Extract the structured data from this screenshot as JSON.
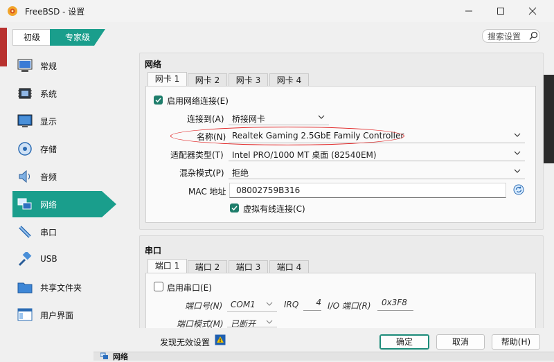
{
  "window": {
    "title": "FreeBSD - 设置"
  },
  "mode_tabs": {
    "basic": "初级",
    "expert": "专家级"
  },
  "search": {
    "placeholder": "搜索设置"
  },
  "sidebar": [
    {
      "label": "常规"
    },
    {
      "label": "系统"
    },
    {
      "label": "显示"
    },
    {
      "label": "存储"
    },
    {
      "label": "音频"
    },
    {
      "label": "网络"
    },
    {
      "label": "串口"
    },
    {
      "label": "USB"
    },
    {
      "label": "共享文件夹"
    },
    {
      "label": "用户界面"
    }
  ],
  "network": {
    "title": "网络",
    "tabs": [
      "网卡 1",
      "网卡 2",
      "网卡 3",
      "网卡 4"
    ],
    "enable_label": "启用网络连接(E)",
    "attached_label": "连接到(A)",
    "attached_value": "桥接网卡",
    "name_label": "名称(N)",
    "name_value": "Realtek Gaming 2.5GbE Family Controller",
    "adapter_type_label": "适配器类型(T)",
    "adapter_type_value": "Intel PRO/1000 MT 桌面 (82540EM)",
    "promisc_label": "混杂模式(P)",
    "promisc_value": "拒绝",
    "mac_label": "MAC 地址",
    "mac_value": "08002759B316",
    "cable_label": "虚拟有线连接(C)"
  },
  "serial": {
    "title": "串口",
    "tabs": [
      "端口 1",
      "端口 2",
      "端口 3",
      "端口 4"
    ],
    "enable_label": "启用串口(E)",
    "port_num_label": "端口号(N)",
    "port_num_value": "COM1",
    "irq_label": "IRQ",
    "irq_value": "4",
    "io_label": "I/O 端口(R)",
    "io_value": "0x3F8",
    "mode_label": "端口模式(M)",
    "mode_value": "已断开"
  },
  "footer": {
    "invalid_label": "发现无效设置",
    "ok": "确定",
    "cancel": "取消",
    "help": "帮助(H)",
    "behind_label": "网络"
  },
  "colors": {
    "accent": "#1a9e8c",
    "annotation": "#e02020"
  }
}
